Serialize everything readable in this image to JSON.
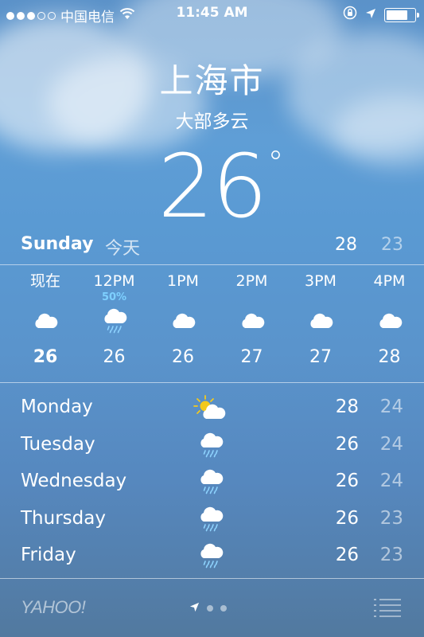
{
  "status_bar": {
    "carrier": "中国电信",
    "time": "11:45 AM",
    "signal_filled": 3,
    "signal_total": 5,
    "battery_level": 0.8
  },
  "header": {
    "city": "上海市",
    "condition": "大部多云",
    "temperature": "26",
    "degree_symbol": "°"
  },
  "today": {
    "day": "Sunday",
    "label": "今天",
    "high": "28",
    "low": "23"
  },
  "hourly": [
    {
      "time": "现在",
      "precip": "",
      "icon": "cloud-icon",
      "temp": "26",
      "now": true
    },
    {
      "time": "12PM",
      "precip": "50%",
      "icon": "cloud-rain-icon",
      "temp": "26",
      "now": false
    },
    {
      "time": "1PM",
      "precip": "",
      "icon": "cloud-icon",
      "temp": "26",
      "now": false
    },
    {
      "time": "2PM",
      "precip": "",
      "icon": "cloud-icon",
      "temp": "27",
      "now": false
    },
    {
      "time": "3PM",
      "precip": "",
      "icon": "cloud-icon",
      "temp": "27",
      "now": false
    },
    {
      "time": "4PM",
      "precip": "",
      "icon": "cloud-icon",
      "temp": "28",
      "now": false
    }
  ],
  "daily": [
    {
      "day": "Monday",
      "icon": "partly-sunny-icon",
      "high": "28",
      "low": "24"
    },
    {
      "day": "Tuesday",
      "icon": "cloud-rain-icon",
      "high": "26",
      "low": "24"
    },
    {
      "day": "Wednesday",
      "icon": "cloud-rain-icon",
      "high": "26",
      "low": "24"
    },
    {
      "day": "Thursday",
      "icon": "cloud-rain-icon",
      "high": "26",
      "low": "23"
    },
    {
      "day": "Friday",
      "icon": "cloud-rain-icon",
      "high": "26",
      "low": "23"
    }
  ],
  "footer": {
    "brand": "YAHOO!",
    "page_count": 3,
    "current_page": 0
  },
  "colors": {
    "sky_top": "#5b92c9",
    "sky_bottom": "#52799f",
    "precip_text": "#7ed0ff",
    "sun": "#f3c91c"
  }
}
